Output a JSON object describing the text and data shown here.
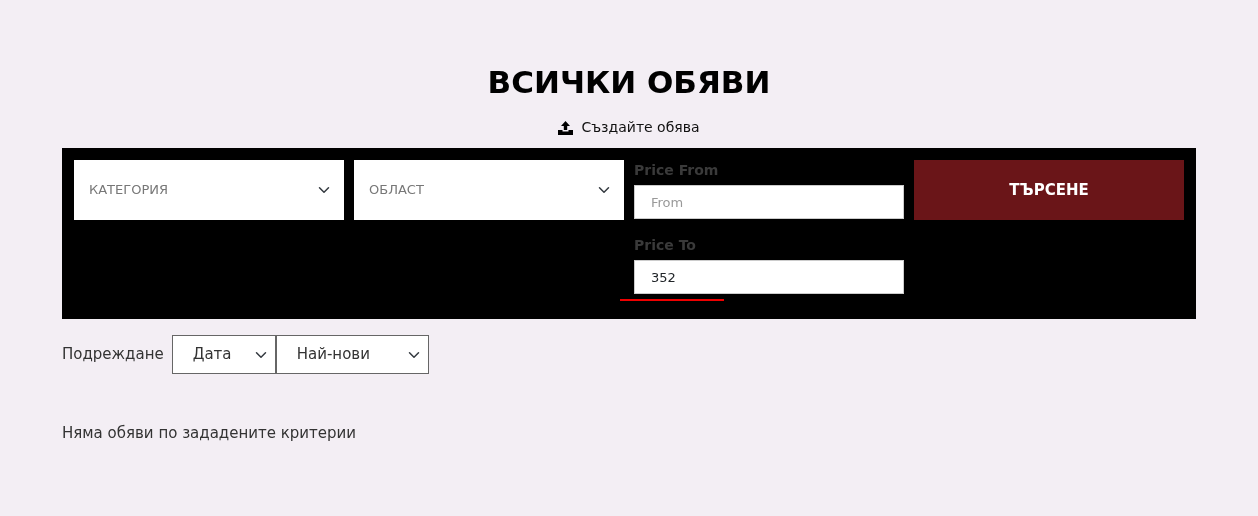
{
  "title": "ВСИЧКИ ОБЯВИ",
  "create_link": "Създайте обява",
  "filters": {
    "category": "КАТЕГОРИЯ",
    "region": "ОБЛАСТ",
    "price_from": {
      "label": "Price From",
      "placeholder": "From"
    },
    "price_to": {
      "label": "Price To",
      "value": "352"
    },
    "search_button": "ТЪРСЕНЕ"
  },
  "sort": {
    "label": "Подреждане",
    "field": "Дата",
    "order": "Най-нови"
  },
  "empty_message": "Няма обяви по зададените критерии"
}
